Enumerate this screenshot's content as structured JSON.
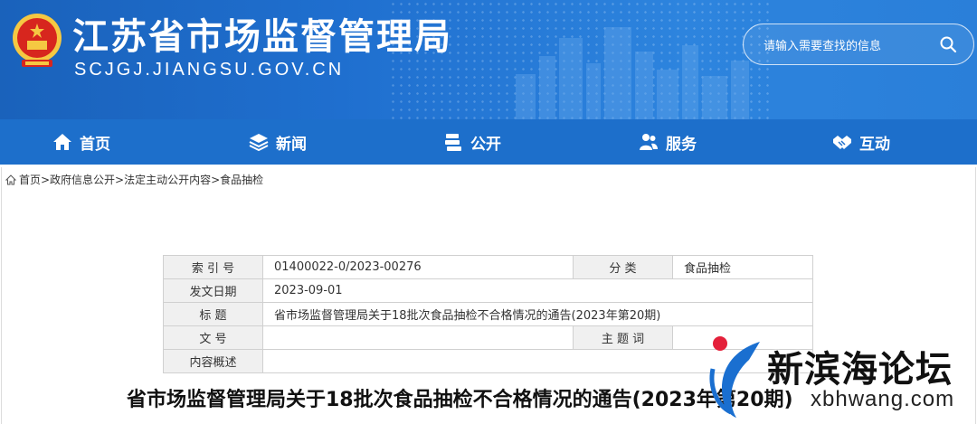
{
  "header": {
    "title": "江苏省市场监督管理局",
    "domain": "SCJGJ.JIANGSU.GOV.CN",
    "search_placeholder": "请输入需要查找的信息"
  },
  "nav": {
    "items": [
      {
        "label": "首页",
        "icon": "home-icon"
      },
      {
        "label": "新闻",
        "icon": "layers-icon"
      },
      {
        "label": "公开",
        "icon": "stack-icon"
      },
      {
        "label": "服务",
        "icon": "people-icon"
      },
      {
        "label": "互动",
        "icon": "handshake-icon"
      }
    ]
  },
  "breadcrumb": {
    "text": "首页>政府信息公开>法定主动公开内容>食品抽检"
  },
  "info_table": {
    "index_label": "索 引 号",
    "index_value": "01400022-0/2023-00276",
    "category_label": "分 类",
    "category_value": "食品抽检",
    "date_label": "发文日期",
    "date_value": "2023-09-01",
    "title_label": "标 题",
    "title_value": "省市场监督管理局关于18批次食品抽检不合格情况的通告(2023年第20期)",
    "docno_label": "文 号",
    "docno_value": "",
    "subject_label": "主 题 词",
    "subject_value": "",
    "summary_label": "内容概述",
    "summary_value": ""
  },
  "article": {
    "title": "省市场监督管理局关于18批次食品抽检不合格情况的通告(2023年第20期)"
  },
  "watermark": {
    "name": "新滨海论坛",
    "url": "xbhwang.com"
  },
  "colors": {
    "header_blue": "#1f6fcf",
    "nav_blue": "#1d6fcb",
    "emblem_red": "#d7261e",
    "emblem_gold": "#f5c842"
  }
}
